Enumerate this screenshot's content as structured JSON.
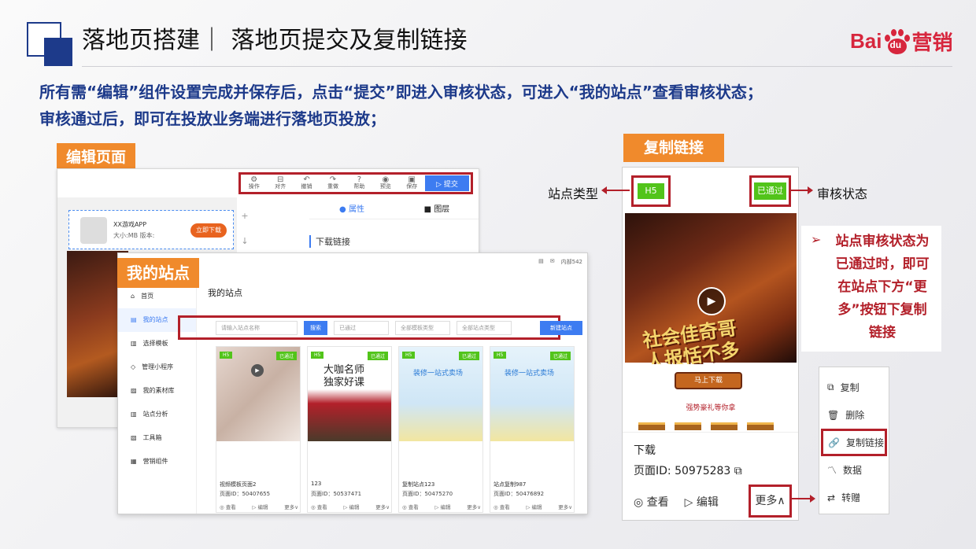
{
  "header": {
    "title": "落地页搭建｜ 落地页提交及复制链接",
    "logo_text_left": "Bai",
    "logo_text_right": "营销",
    "logo_paw_text": "du"
  },
  "description": [
    "所有需“编辑”组件设置完成并保存后，点击“提交”即进入审核状态，可进入“我的站点”查看审核状态；",
    "审核通过后，即可在投放业务端进行落地页投放；"
  ],
  "tags": {
    "edit_page": "编辑页面",
    "my_sites": "我的站点",
    "copy_link": "复制链接"
  },
  "editor": {
    "toolbar": [
      "操作",
      "对齐",
      "撤销",
      "重做",
      "帮助",
      "预览",
      "保存"
    ],
    "submit": "▷ 提交",
    "app_name": "XX游戏APP",
    "app_meta": "大小:MB 版本:",
    "download_button": "立即下载",
    "tab_property": "属性",
    "tab_layer": "图层",
    "download_link_label": "下载链接"
  },
  "sites": {
    "top_right": "内部542",
    "nav": [
      "首页",
      "我的站点",
      "选择模板",
      "管理小程序",
      "我的素材库",
      "站点分析",
      "工具箱",
      "营销组件"
    ],
    "page_title": "我的站点",
    "search_placeholder": "请输入站点名称",
    "search_button": "搜索",
    "filter_status": "已通过",
    "filter_template": "全部模板类型",
    "filter_site": "全部站点类型",
    "new_button": "新建站点",
    "cards": [
      {
        "h5": "H5",
        "status": "已通过",
        "name": "视频模板页面2",
        "pid": "页面ID：50407655",
        "thumb_text": ""
      },
      {
        "h5": "H5",
        "status": "已通过",
        "name": "123",
        "pid": "页面ID：50537471",
        "thumb_text": "大咖名师\n独家好课"
      },
      {
        "h5": "H5",
        "status": "已通过",
        "name": "复制站点123",
        "pid": "页面ID：50475270",
        "thumb_text": "装修一站式卖场"
      },
      {
        "h5": "H5",
        "status": "已通过",
        "name": "站点复制987",
        "pid": "页面ID：50476892",
        "thumb_text": "装修一站式卖场"
      }
    ],
    "card_actions": [
      "◎ 查看",
      "▷ 编辑",
      "更多∨"
    ]
  },
  "copy_panel": {
    "type_badge": "H5",
    "status_badge": "已通过",
    "slogan": "社会佳奇哥\n人报恬不多",
    "download": "马上下载",
    "gift": "强势豪礼等你拿",
    "name": "下载",
    "page_id": "页面ID:  50975283",
    "view": "◎ 查看",
    "edit": "▷ 编辑",
    "more": "更多∧"
  },
  "labels": {
    "site_type": "站点类型",
    "review_status": "审核状态"
  },
  "note": {
    "bullet": "➢",
    "text": "站点审核状态为已通过时，即可在站点下方“更多”按钮下复制链接"
  },
  "menu": {
    "items": [
      {
        "icon": "⧉",
        "label": "复制"
      },
      {
        "icon": "🗑",
        "label": "删除"
      },
      {
        "icon": "🔗",
        "label": "复制链接"
      },
      {
        "icon": "〽",
        "label": "数据"
      },
      {
        "icon": "⇄",
        "label": "转赠"
      }
    ]
  },
  "colors": {
    "accent_blue": "#1d3a8a",
    "highlight_red": "#b3202a",
    "tag_orange": "#f08a2c",
    "status_green": "#52c41a"
  }
}
